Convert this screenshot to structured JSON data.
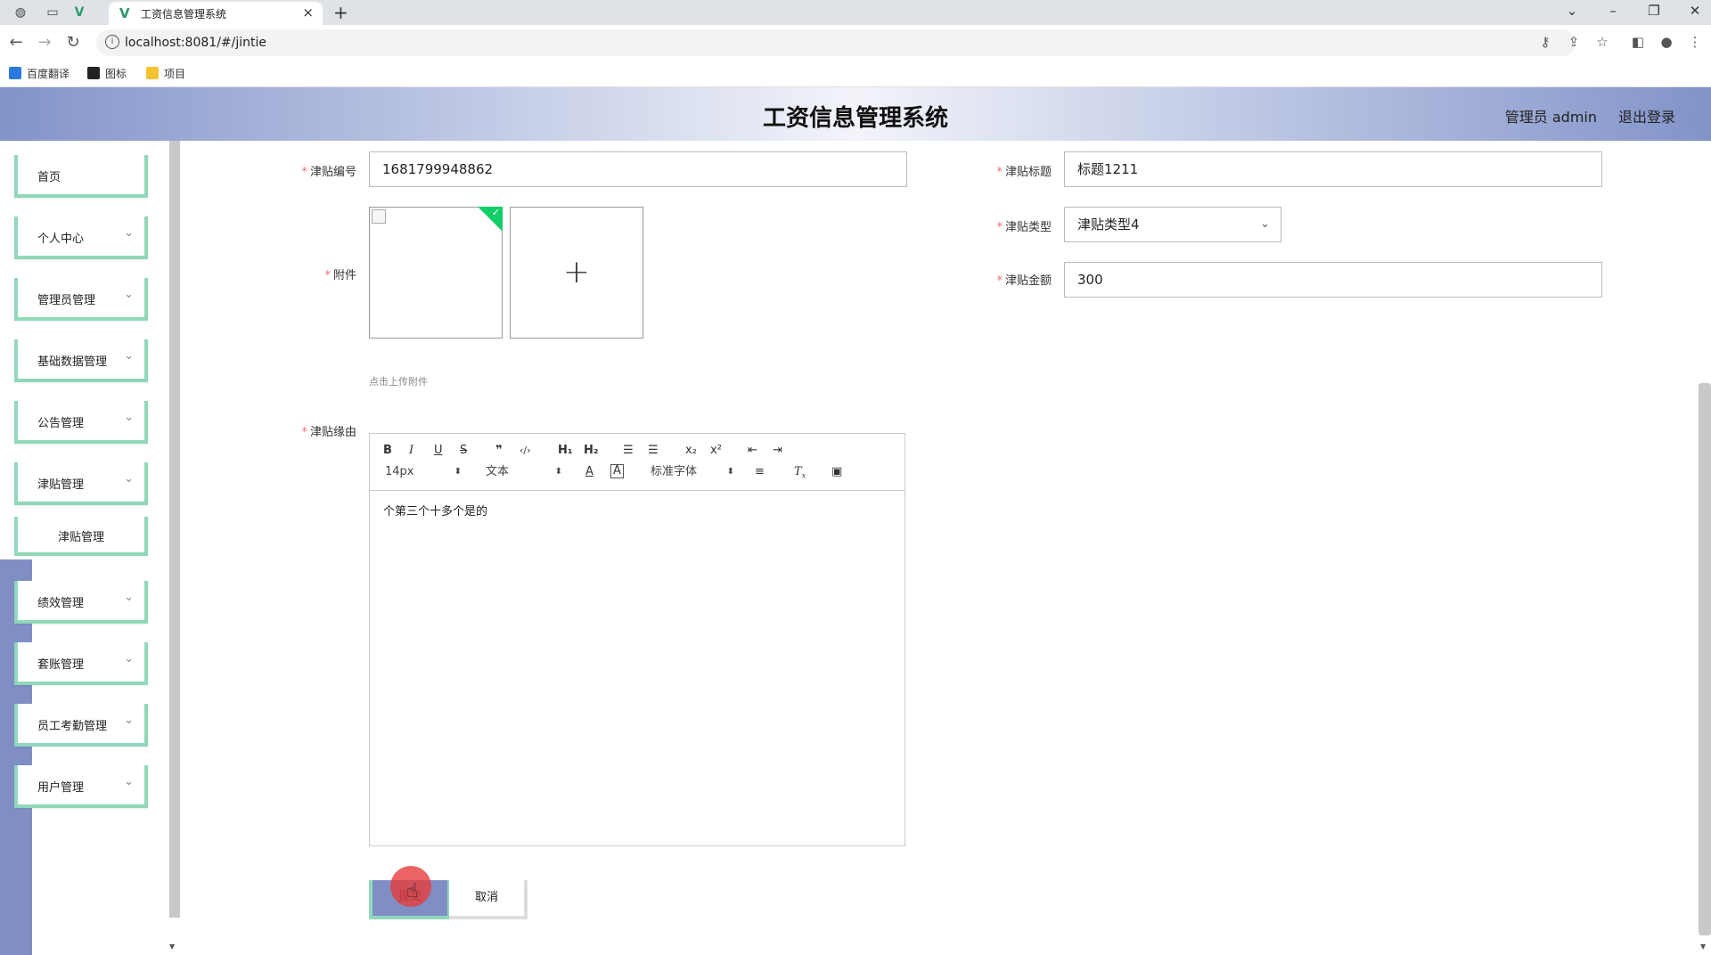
{
  "browser": {
    "tab_title": "工资信息管理系统",
    "url": "localhost:8081/#/jintie",
    "bookmarks": [
      "百度翻译",
      "图标",
      "项目"
    ]
  },
  "header": {
    "title": "工资信息管理系统",
    "user": "管理员 admin",
    "logout": "退出登录"
  },
  "sidebar": {
    "items": [
      {
        "label": "首页"
      },
      {
        "label": "个人中心"
      },
      {
        "label": "管理员管理"
      },
      {
        "label": "基础数据管理"
      },
      {
        "label": "公告管理"
      },
      {
        "label": "津贴管理"
      },
      {
        "label": "津贴管理"
      },
      {
        "label": "绩效管理"
      },
      {
        "label": "套账管理"
      },
      {
        "label": "员工考勤管理"
      },
      {
        "label": "用户管理"
      }
    ]
  },
  "form": {
    "number_label": "津贴编号",
    "number_value": "1681799948862",
    "title_label": "津贴标题",
    "title_value": "标题1211",
    "attachment_label": "附件",
    "upload_tip": "点击上传附件",
    "type_label": "津贴类型",
    "type_value": "津贴类型4",
    "amount_label": "津贴金额",
    "amount_value": "300",
    "reason_label": "津贴缘由",
    "reason_content": "个第三个十多个是的"
  },
  "editor": {
    "font_size": "14px",
    "block_format": "文本",
    "font_family": "标准字体"
  },
  "buttons": {
    "submit": "提交",
    "cancel": "取消"
  }
}
